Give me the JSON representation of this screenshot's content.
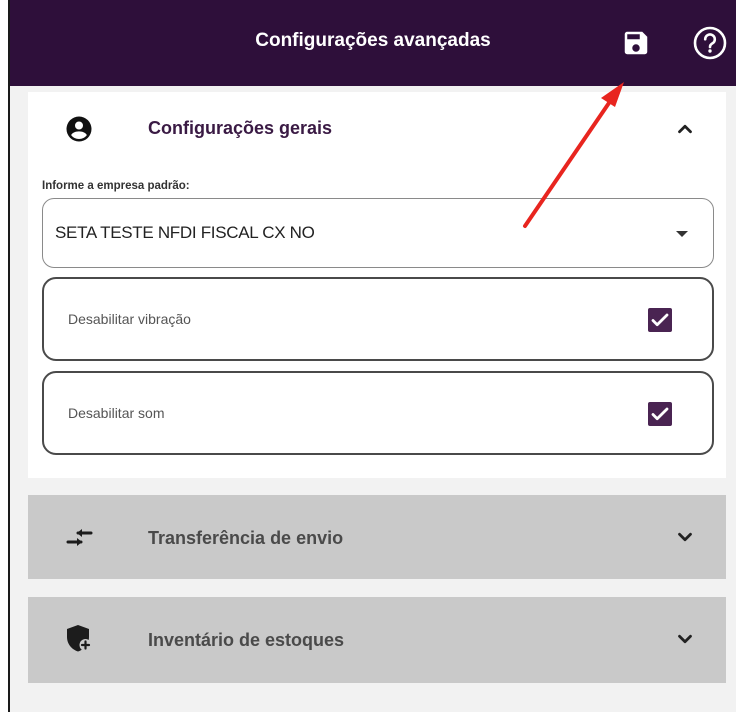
{
  "header": {
    "title": "Configurações avançadas",
    "save_icon": "save-icon",
    "help_icon": "help-icon",
    "color": "#2e0f3a"
  },
  "general_settings": {
    "title": "Configurações gerais",
    "icon": "account-circle-icon",
    "expanded": true,
    "company_label": "Informe a empresa padrão:",
    "company_value": "SETA TESTE NFDI FISCAL CX NO",
    "options": [
      {
        "label": "Desabilitar vibração",
        "checked": true
      },
      {
        "label": "Desabilitar som",
        "checked": true
      }
    ]
  },
  "sections": [
    {
      "title": "Transferência de envio",
      "icon": "transfer-arrows-icon",
      "expanded": false
    },
    {
      "title": "Inventário de estoques",
      "icon": "shield-plus-icon",
      "expanded": false
    }
  ],
  "annotation": {
    "type": "red-arrow",
    "points_to": "save-button",
    "color": "#e8251f"
  }
}
